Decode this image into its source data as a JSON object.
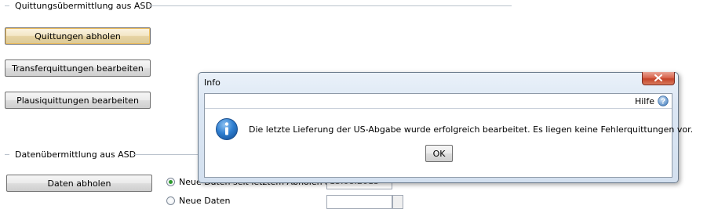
{
  "section_receipts": {
    "title": "Quittungsübermittlung aus ASD",
    "buttons": {
      "fetch_receipts": "Quittungen abholen",
      "edit_transfer_receipts": "Transferquittungen bearbeiten",
      "edit_plausi_receipts": "Plausiquittungen bearbeiten"
    }
  },
  "section_data": {
    "title": "Datenübermittlung aus ASD",
    "fetch_data_button": "Daten abholen",
    "radio_option_1": "Neue Daten seit letztem Abholen ab",
    "radio_option_2": "Neue Daten",
    "date_value": "13.08.2013"
  },
  "dialog": {
    "title": "Info",
    "help_label": "Hilfe",
    "message": "Die letzte Lieferung der US-Abgabe wurde erfolgreich bearbeitet. Es liegen keine Fehlerquittungen vor.",
    "ok_label": "OK",
    "icon": "info-icon",
    "colors": {
      "close_button": "#c4442a",
      "info_icon": "#1f6fc4"
    }
  }
}
